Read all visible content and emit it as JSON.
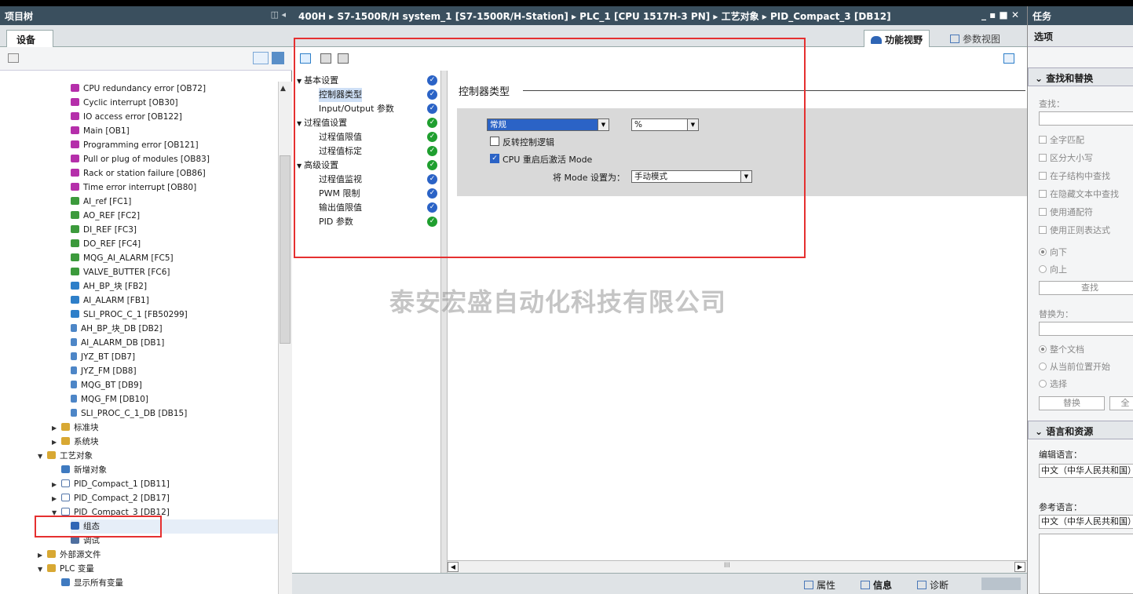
{
  "left_panel": {
    "title": "项目树",
    "title_controls": "◫ ◂",
    "device_tab": "设备",
    "tree": [
      {
        "label": "CPU redundancy error [OB72]",
        "type": "ob",
        "level": 3
      },
      {
        "label": "Cyclic interrupt [OB30]",
        "type": "ob",
        "level": 3
      },
      {
        "label": "IO access error [OB122]",
        "type": "ob",
        "level": 3
      },
      {
        "label": "Main [OB1]",
        "type": "ob",
        "level": 3
      },
      {
        "label": "Programming error [OB121]",
        "type": "ob",
        "level": 3
      },
      {
        "label": "Pull or plug of modules [OB83]",
        "type": "ob",
        "level": 3
      },
      {
        "label": "Rack or station failure [OB86]",
        "type": "ob",
        "level": 3
      },
      {
        "label": "Time error interrupt [OB80]",
        "type": "ob",
        "level": 3
      },
      {
        "label": "AI_ref [FC1]",
        "type": "fc",
        "level": 3
      },
      {
        "label": "AO_REF [FC2]",
        "type": "fc",
        "level": 3
      },
      {
        "label": "DI_REF [FC3]",
        "type": "fc",
        "level": 3
      },
      {
        "label": "DO_REF [FC4]",
        "type": "fc",
        "level": 3
      },
      {
        "label": "MQG_AI_ALARM [FC5]",
        "type": "fc",
        "level": 3
      },
      {
        "label": "VALVE_BUTTER [FC6]",
        "type": "fc",
        "level": 3
      },
      {
        "label": "AH_BP_块 [FB2]",
        "type": "fb",
        "level": 3
      },
      {
        "label": "AI_ALARM [FB1]",
        "type": "fb",
        "level": 3
      },
      {
        "label": "SLI_PROC_C_1 [FB50299]",
        "type": "fb",
        "level": 3
      },
      {
        "label": "AH_BP_块_DB [DB2]",
        "type": "db",
        "level": 3
      },
      {
        "label": "AI_ALARM_DB [DB1]",
        "type": "db",
        "level": 3
      },
      {
        "label": "JYZ_BT [DB7]",
        "type": "db",
        "level": 3
      },
      {
        "label": "JYZ_FM [DB8]",
        "type": "db",
        "level": 3
      },
      {
        "label": "MQG_BT [DB9]",
        "type": "db",
        "level": 3
      },
      {
        "label": "MQG_FM [DB10]",
        "type": "db",
        "level": 3
      },
      {
        "label": "SLI_PROC_C_1_DB [DB15]",
        "type": "db",
        "level": 3
      },
      {
        "label": "标准块",
        "type": "fld",
        "level": 2,
        "arrow": "▶"
      },
      {
        "label": "系统块",
        "type": "fld",
        "level": 2,
        "arrow": "▶"
      },
      {
        "label": "工艺对象",
        "type": "tech",
        "level": 1,
        "arrow": "▼"
      },
      {
        "label": "新增对象",
        "type": "new",
        "level": 2
      },
      {
        "label": "PID_Compact_1 [DB11]",
        "type": "pid",
        "level": 2,
        "arrow": "▶"
      },
      {
        "label": "PID_Compact_2 [DB17]",
        "type": "pid",
        "level": 2,
        "arrow": "▶"
      },
      {
        "label": "PID_Compact_3 [DB12]",
        "type": "pid",
        "level": 2,
        "arrow": "▼"
      },
      {
        "label": "组态",
        "type": "cfg",
        "level": 3,
        "selected": true
      },
      {
        "label": "调试",
        "type": "dbg",
        "level": 3
      },
      {
        "label": "外部源文件",
        "type": "fld",
        "level": 1,
        "arrow": "▶"
      },
      {
        "label": "PLC 变量",
        "type": "fld",
        "level": 1,
        "arrow": "▼"
      },
      {
        "label": "显示所有变量",
        "type": "new",
        "level": 2
      }
    ]
  },
  "editor": {
    "breadcrumb": "400H ▸ S7-1500R/H system_1 [S7-1500R/H-Station] ▸ PLC_1 [CPU 1517H-3 PN] ▸ 工艺对象 ▸ PID_Compact_3 [DB12]",
    "window_controls": "_ ▪ ■ ✕",
    "view_tabs": {
      "function_view": "功能视野",
      "param_view": "参数视图"
    },
    "nav": [
      {
        "label": "基本设置",
        "level": 0,
        "arrow": "▼",
        "status": "blue"
      },
      {
        "label": "控制器类型",
        "level": 1,
        "status": "blue",
        "selected": true
      },
      {
        "label": "Input/Output 参数",
        "level": 1,
        "status": "blue"
      },
      {
        "label": "过程值设置",
        "level": 0,
        "arrow": "▼",
        "status": "green"
      },
      {
        "label": "过程值限值",
        "level": 1,
        "status": "green"
      },
      {
        "label": "过程值标定",
        "level": 1,
        "status": "green"
      },
      {
        "label": "高级设置",
        "level": 0,
        "arrow": "▼",
        "status": "green"
      },
      {
        "label": "过程值监视",
        "level": 1,
        "status": "blue"
      },
      {
        "label": "PWM 限制",
        "level": 1,
        "status": "blue"
      },
      {
        "label": "输出值限值",
        "level": 1,
        "status": "blue"
      },
      {
        "label": "PID 参数",
        "level": 1,
        "status": "green"
      }
    ],
    "section_title": "控制器类型",
    "controller_type": "常规",
    "unit": "%",
    "invert_label": "反转控制逻辑",
    "invert_checked": false,
    "activate_label": "CPU 重启后激活 Mode",
    "activate_checked": true,
    "mode_label": "将 Mode 设置为：",
    "mode_value": "手动模式",
    "watermark": "泰安宏盛自动化科技有限公司",
    "bottom_tabs": {
      "properties": "属性",
      "info": "信息",
      "diagnostics": "诊断"
    },
    "hscroll_mid": "III"
  },
  "task_pane": {
    "title": "任务",
    "options": "选项",
    "find_replace": {
      "header": "查找和替换",
      "find_label": "查找：",
      "checks": [
        "全字匹配",
        "区分大小写",
        "在子结构中查找",
        "在隐藏文本中查找",
        "使用通配符",
        "使用正则表达式"
      ],
      "dir_down": "向下",
      "dir_up": "向上",
      "find_button": "查找",
      "replace_label": "替换为：",
      "scope": [
        "整个文档",
        "从当前位置开始",
        "选择"
      ],
      "replace_button": "替换",
      "replace_all_button": "全"
    },
    "lang": {
      "header": "语言和资源",
      "edit_label": "编辑语言：",
      "edit_value": "中文（中华人民共和国）",
      "ref_label": "参考语言：",
      "ref_value": "中文（中华人民共和国）"
    }
  },
  "colors": {
    "title_bar": "#3a4f5e",
    "highlight_red": "#e53030",
    "check_blue": "#2b63c6",
    "check_green": "#1f9f2f"
  }
}
